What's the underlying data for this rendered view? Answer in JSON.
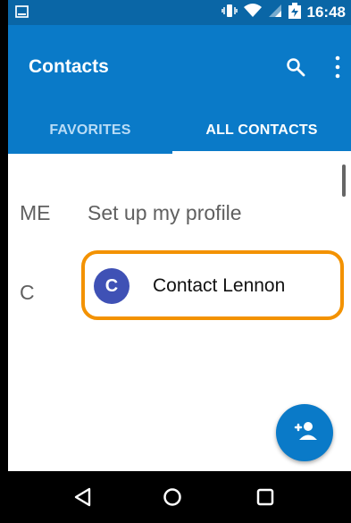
{
  "status_bar": {
    "time": "16:48"
  },
  "app_bar": {
    "title": "Contacts"
  },
  "tabs": [
    {
      "label": "FAVORITES",
      "selected": false
    },
    {
      "label": "ALL CONTACTS",
      "selected": true
    }
  ],
  "profile_section": {
    "letter": "ME",
    "label": "Set up my profile"
  },
  "contact_section": {
    "letter": "C",
    "avatar_initial": "C",
    "name": "Contact Lennon"
  },
  "icons": {
    "status": [
      "gallery-notification-icon",
      "vibrate-icon",
      "wifi-icon",
      "cellular-signal-icon",
      "battery-charging-icon"
    ],
    "actions": [
      "search-icon",
      "more-vert-icon",
      "add-contact-icon"
    ],
    "navigation": [
      "back-icon",
      "home-icon",
      "recents-icon"
    ]
  },
  "colors": {
    "status_bar": "#0a66a6",
    "app_bar": "#0a7ac8",
    "avatar": "#3f51b5",
    "highlight": "#f39200"
  }
}
